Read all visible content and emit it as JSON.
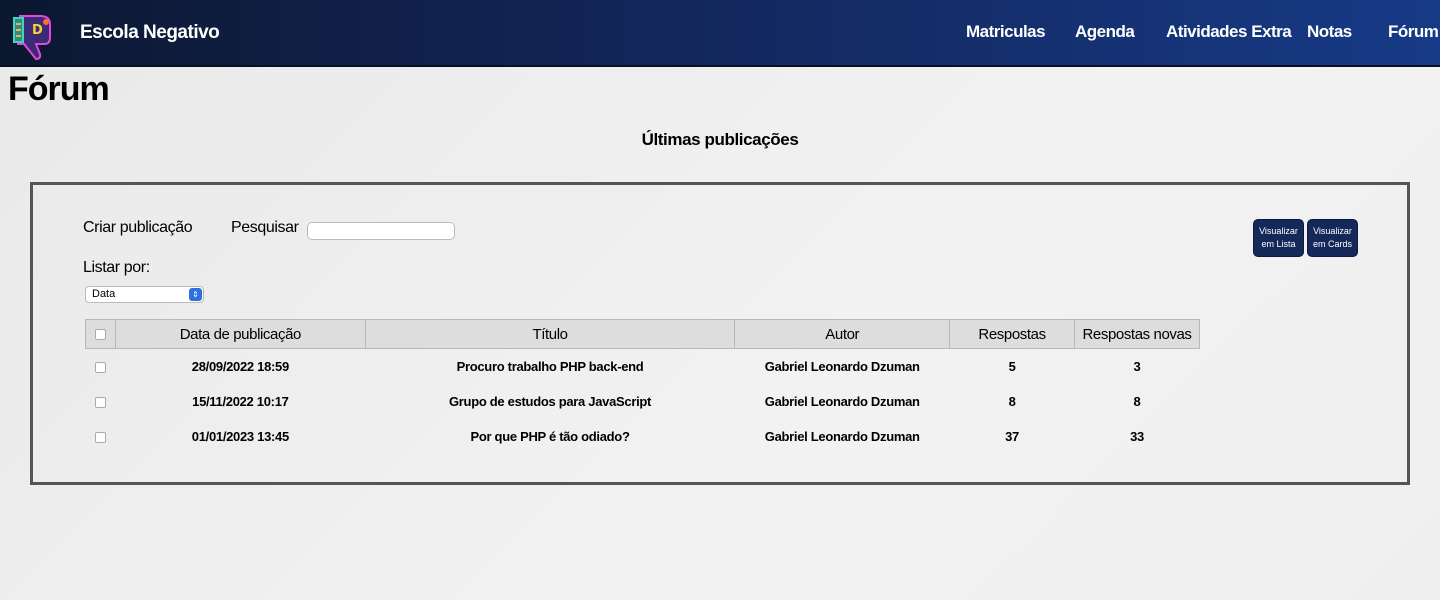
{
  "brand": "Escola Negativo",
  "nav": [
    "Matriculas",
    "Agenda",
    "Atividades Extra",
    "Notas",
    "Fórum"
  ],
  "page_title": "Fórum",
  "subtitle": "Últimas publicações",
  "toolbar": {
    "create_label": "Criar publicação",
    "search_label": "Pesquisar",
    "search_value": "",
    "list_by_label": "Listar por:",
    "list_by_selected": "Data",
    "view_list_label": [
      "Visualizar",
      "em Lista"
    ],
    "view_cards_label": [
      "Visualizar",
      "em Cards"
    ]
  },
  "table": {
    "headers": [
      "Data de publicação",
      "Título",
      "Autor",
      "Respostas",
      "Respostas novas"
    ],
    "rows": [
      [
        "28/09/2022 18:59",
        "Procuro trabalho PHP back-end",
        "Gabriel Leonardo Dzuman",
        "5",
        "3"
      ],
      [
        "15/11/2022 10:17",
        "Grupo de estudos para JavaScript",
        "Gabriel Leonardo Dzuman",
        "8",
        "8"
      ],
      [
        "01/01/2023 13:45",
        "Por que PHP é tão odiado?",
        "Gabriel Leonardo Dzuman",
        "37",
        "33"
      ]
    ]
  },
  "colors": {
    "nav_start": "#0c1730",
    "nav_end": "#173a86",
    "button": "#14285a"
  },
  "icons": {
    "logo": "thumbs-down-logo-icon"
  }
}
